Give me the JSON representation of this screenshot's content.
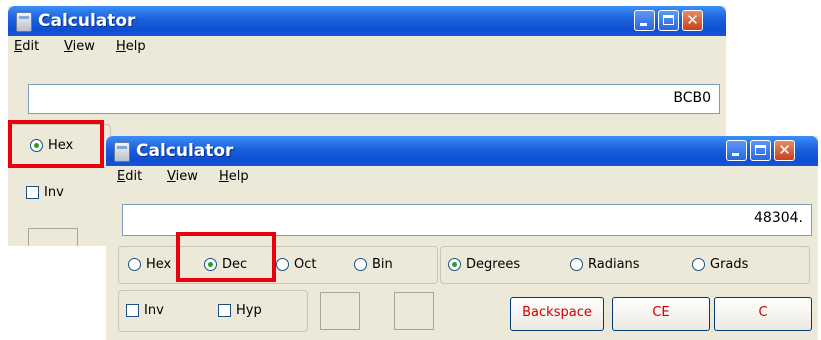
{
  "back_window": {
    "title": "Calculator",
    "menu": [
      "Edit",
      "View",
      "Help"
    ],
    "display_value": "BCB0",
    "hex_label": "Hex",
    "inv_label": "Inv"
  },
  "front_window": {
    "title": "Calculator",
    "menu": [
      "Edit",
      "View",
      "Help"
    ],
    "display_value": "48304.",
    "base_radios": [
      "Hex",
      "Dec",
      "Oct",
      "Bin"
    ],
    "selected_base": "Dec",
    "angle_radios": [
      "Degrees",
      "Radians",
      "Grads"
    ],
    "selected_angle": "Degrees",
    "inv_label": "Inv",
    "hyp_label": "Hyp",
    "backspace_label": "Backspace",
    "ce_label": "CE",
    "c_label": "C"
  },
  "colors": {
    "titlebar": "#0e4ed2",
    "highlight": "#e8000c",
    "button_text": "#cc0000"
  }
}
